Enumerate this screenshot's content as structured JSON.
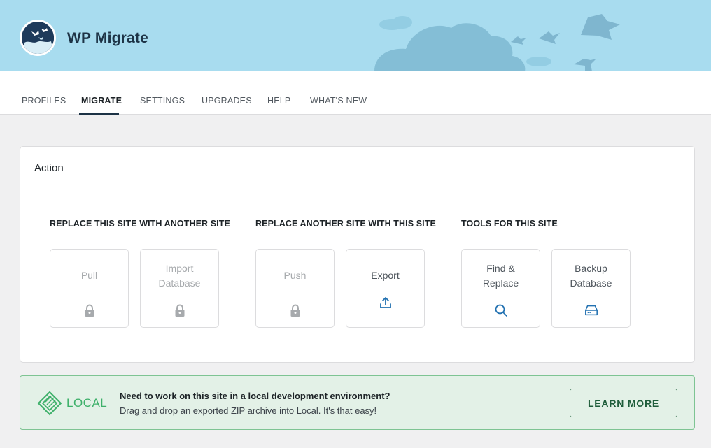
{
  "header": {
    "app_title": "WP Migrate"
  },
  "tabs": [
    {
      "label": "PROFILES"
    },
    {
      "label": "MIGRATE",
      "active": true
    },
    {
      "label": "SETTINGS"
    },
    {
      "label": "UPGRADES"
    },
    {
      "label": "HELP"
    },
    {
      "label": "WHAT'S NEW"
    }
  ],
  "action_panel": {
    "title": "Action",
    "groups": [
      {
        "title": "REPLACE THIS SITE WITH ANOTHER SITE",
        "cards": [
          {
            "label": "Pull",
            "icon": "lock-icon",
            "disabled": true
          },
          {
            "label_lines": [
              "Import",
              "Database"
            ],
            "icon": "lock-icon",
            "disabled": true
          }
        ]
      },
      {
        "title": "REPLACE ANOTHER SITE WITH THIS SITE",
        "cards": [
          {
            "label": "Push",
            "icon": "lock-icon",
            "disabled": true
          },
          {
            "label": "Export",
            "icon": "upload-icon",
            "disabled": false
          }
        ]
      },
      {
        "title": "TOOLS FOR THIS SITE",
        "cards": [
          {
            "label_lines": [
              "Find &",
              "Replace"
            ],
            "icon": "search-icon",
            "disabled": false
          },
          {
            "label_lines": [
              "Backup",
              "Database"
            ],
            "icon": "drive-icon",
            "disabled": false
          }
        ]
      }
    ]
  },
  "local_banner": {
    "logo_text": "LOCAL",
    "title": "Need to work on this site in a local development environment?",
    "description": "Drag and drop an exported ZIP archive into Local. It's that easy!",
    "button_label": "LEARN MORE"
  },
  "colors": {
    "header_bg": "#a8dcef",
    "accent_blue": "#2271b1",
    "disabled_gray": "#a7aaad",
    "local_green": "#3eb06a",
    "banner_bg": "#e3f1e7"
  }
}
